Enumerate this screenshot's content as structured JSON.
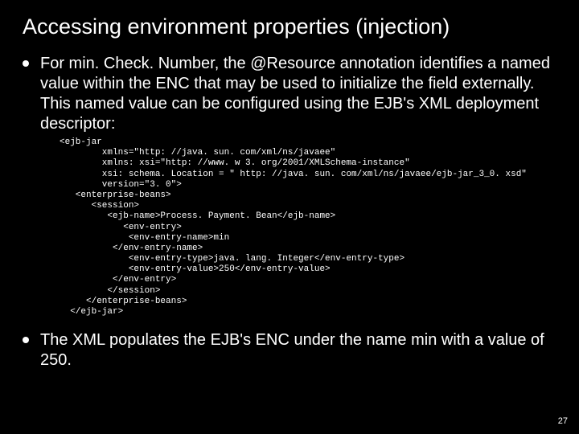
{
  "title": "Accessing environment properties (injection)",
  "bullets": {
    "b1": "For min. Check. Number, the @Resource annotation identifies a named value within the ENC that may be used to initialize the field externally. This named value can be configured using the EJB's XML deployment descriptor:",
    "b2": "The XML populates the EJB's ENC under the name min with a value of 250."
  },
  "code": "<ejb-jar\n        xmlns=\"http: //java. sun. com/xml/ns/javaee\"\n        xmlns: xsi=\"http: //www. w 3. org/2001/XMLSchema-instance\"\n        xsi: schema. Location = \" http: //java. sun. com/xml/ns/javaee/ejb-jar_3_0. xsd\"\n        version=\"3. 0\">\n   <enterprise-beans>\n      <session>\n         <ejb-name>Process. Payment. Bean</ejb-name>\n            <env-entry>\n             <env-entry-name>min\n          </env-entry-name>\n             <env-entry-type>java. lang. Integer</env-entry-type>\n             <env-entry-value>250</env-entry-value>\n          </env-entry>\n         </session>\n     </enterprise-beans>\n  </ejb-jar>",
  "page_number": "27"
}
